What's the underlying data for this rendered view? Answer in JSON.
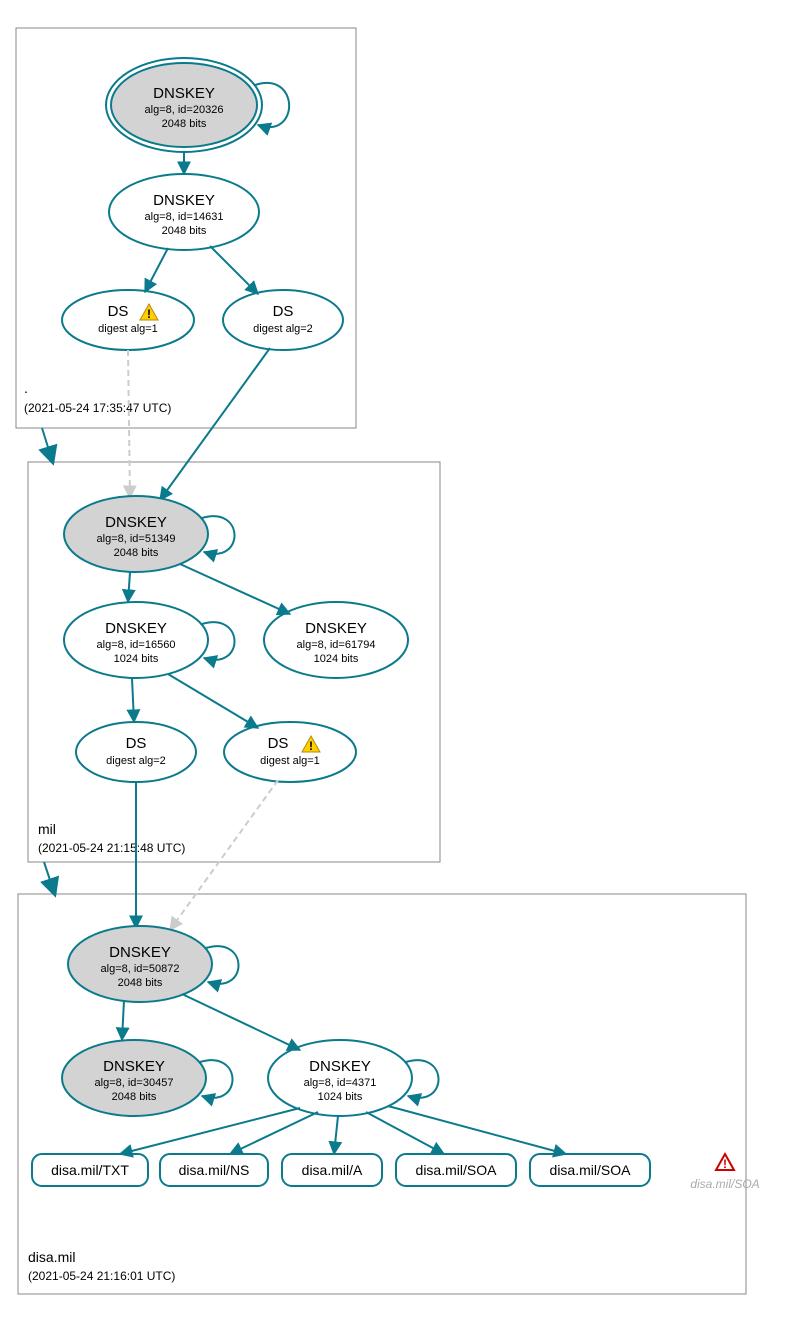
{
  "colors": {
    "primary": "#0a7a8c",
    "warning": "#ffd000",
    "warning_border": "#b8860b",
    "error": "#cc0000",
    "node_fill": "#d3d3d3"
  },
  "zones": [
    {
      "name": ".",
      "timestamp": "(2021-05-24 17:35:47 UTC)",
      "nodes": [
        {
          "id": "root-ksk",
          "title": "DNSKEY",
          "line1": "alg=8, id=20326",
          "line2": "2048 bits",
          "grey": true,
          "double_border": true
        },
        {
          "id": "root-zsk",
          "title": "DNSKEY",
          "line1": "alg=8, id=14631",
          "line2": "2048 bits",
          "grey": false
        },
        {
          "id": "root-ds1",
          "title": "DS",
          "line1": "digest alg=1",
          "line2": "",
          "grey": false,
          "warning": true
        },
        {
          "id": "root-ds2",
          "title": "DS",
          "line1": "digest alg=2",
          "line2": "",
          "grey": false
        }
      ]
    },
    {
      "name": "mil",
      "timestamp": "(2021-05-24 21:15:48 UTC)",
      "nodes": [
        {
          "id": "mil-ksk",
          "title": "DNSKEY",
          "line1": "alg=8, id=51349",
          "line2": "2048 bits",
          "grey": true
        },
        {
          "id": "mil-zsk1",
          "title": "DNSKEY",
          "line1": "alg=8, id=16560",
          "line2": "1024 bits",
          "grey": false
        },
        {
          "id": "mil-zsk2",
          "title": "DNSKEY",
          "line1": "alg=8, id=61794",
          "line2": "1024 bits",
          "grey": false
        },
        {
          "id": "mil-ds2",
          "title": "DS",
          "line1": "digest alg=2",
          "line2": "",
          "grey": false
        },
        {
          "id": "mil-ds1",
          "title": "DS",
          "line1": "digest alg=1",
          "line2": "",
          "grey": false,
          "warning": true
        }
      ]
    },
    {
      "name": "disa.mil",
      "timestamp": "(2021-05-24 21:16:01 UTC)",
      "nodes": [
        {
          "id": "disa-ksk",
          "title": "DNSKEY",
          "line1": "alg=8, id=50872",
          "line2": "2048 bits",
          "grey": true
        },
        {
          "id": "disa-zsk1",
          "title": "DNSKEY",
          "line1": "alg=8, id=30457",
          "line2": "2048 bits",
          "grey": true
        },
        {
          "id": "disa-zsk2",
          "title": "DNSKEY",
          "line1": "alg=8, id=4371",
          "line2": "1024 bits",
          "grey": false
        }
      ],
      "rrsets": [
        {
          "label": "disa.mil/TXT"
        },
        {
          "label": "disa.mil/NS"
        },
        {
          "label": "disa.mil/A"
        },
        {
          "label": "disa.mil/SOA"
        },
        {
          "label": "disa.mil/SOA"
        }
      ],
      "external": {
        "label": "disa.mil/SOA",
        "error": true
      }
    }
  ]
}
